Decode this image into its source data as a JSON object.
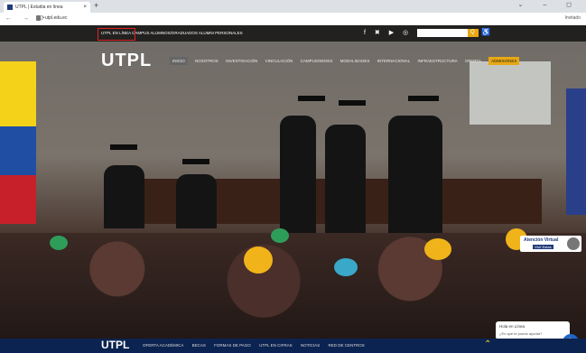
{
  "browser": {
    "tab_title": "UTPL | Estudia en línea",
    "tab_close": "×",
    "new_tab": "+",
    "window_controls": "⌄  –  ◻",
    "nav_buttons": "← → ⟳",
    "url": "utpl.edu.ec",
    "profile_label": "Invitado"
  },
  "site": {
    "top_links": "UTPL EN LÍNEA  CAMPUS  ALUMNOS/GRADUADOS  ALUMNI  PERSONALES",
    "social": "f ✖ ▶ ◎ •••",
    "search_btn": "Q",
    "access_icon": "♿",
    "logo": "UTPL",
    "menu": [
      "INICIO",
      "NOSOTROS",
      "INVESTIGACIÓN",
      "VINCULACIÓN",
      "CAMPUS/SEDES",
      "MODALIDADES",
      "INTERNACIONAL",
      "INFRAESTRUCTURA",
      "OFERTA",
      "ADMISIONES"
    ],
    "chat_title": "Atención Virtual",
    "chat_subtitle": "Vivi! Estas",
    "msg_line1": "Hola en Línea",
    "msg_line2": "¿En qué te puedo ayudar?",
    "hand_icon": "✋",
    "bottom_logo": "UTPL",
    "bottom_links": [
      "OFERTA ACADÉMICA",
      "BECAS",
      "FORMAS DE PAGO",
      "UTPL EN CIFRAS",
      "NOTICIAS",
      "RED DE CENTROS"
    ],
    "chevron": "⌃"
  },
  "colors": {
    "accent": "#e7a813",
    "navy": "#0b2350",
    "highlight": "#e02020"
  }
}
